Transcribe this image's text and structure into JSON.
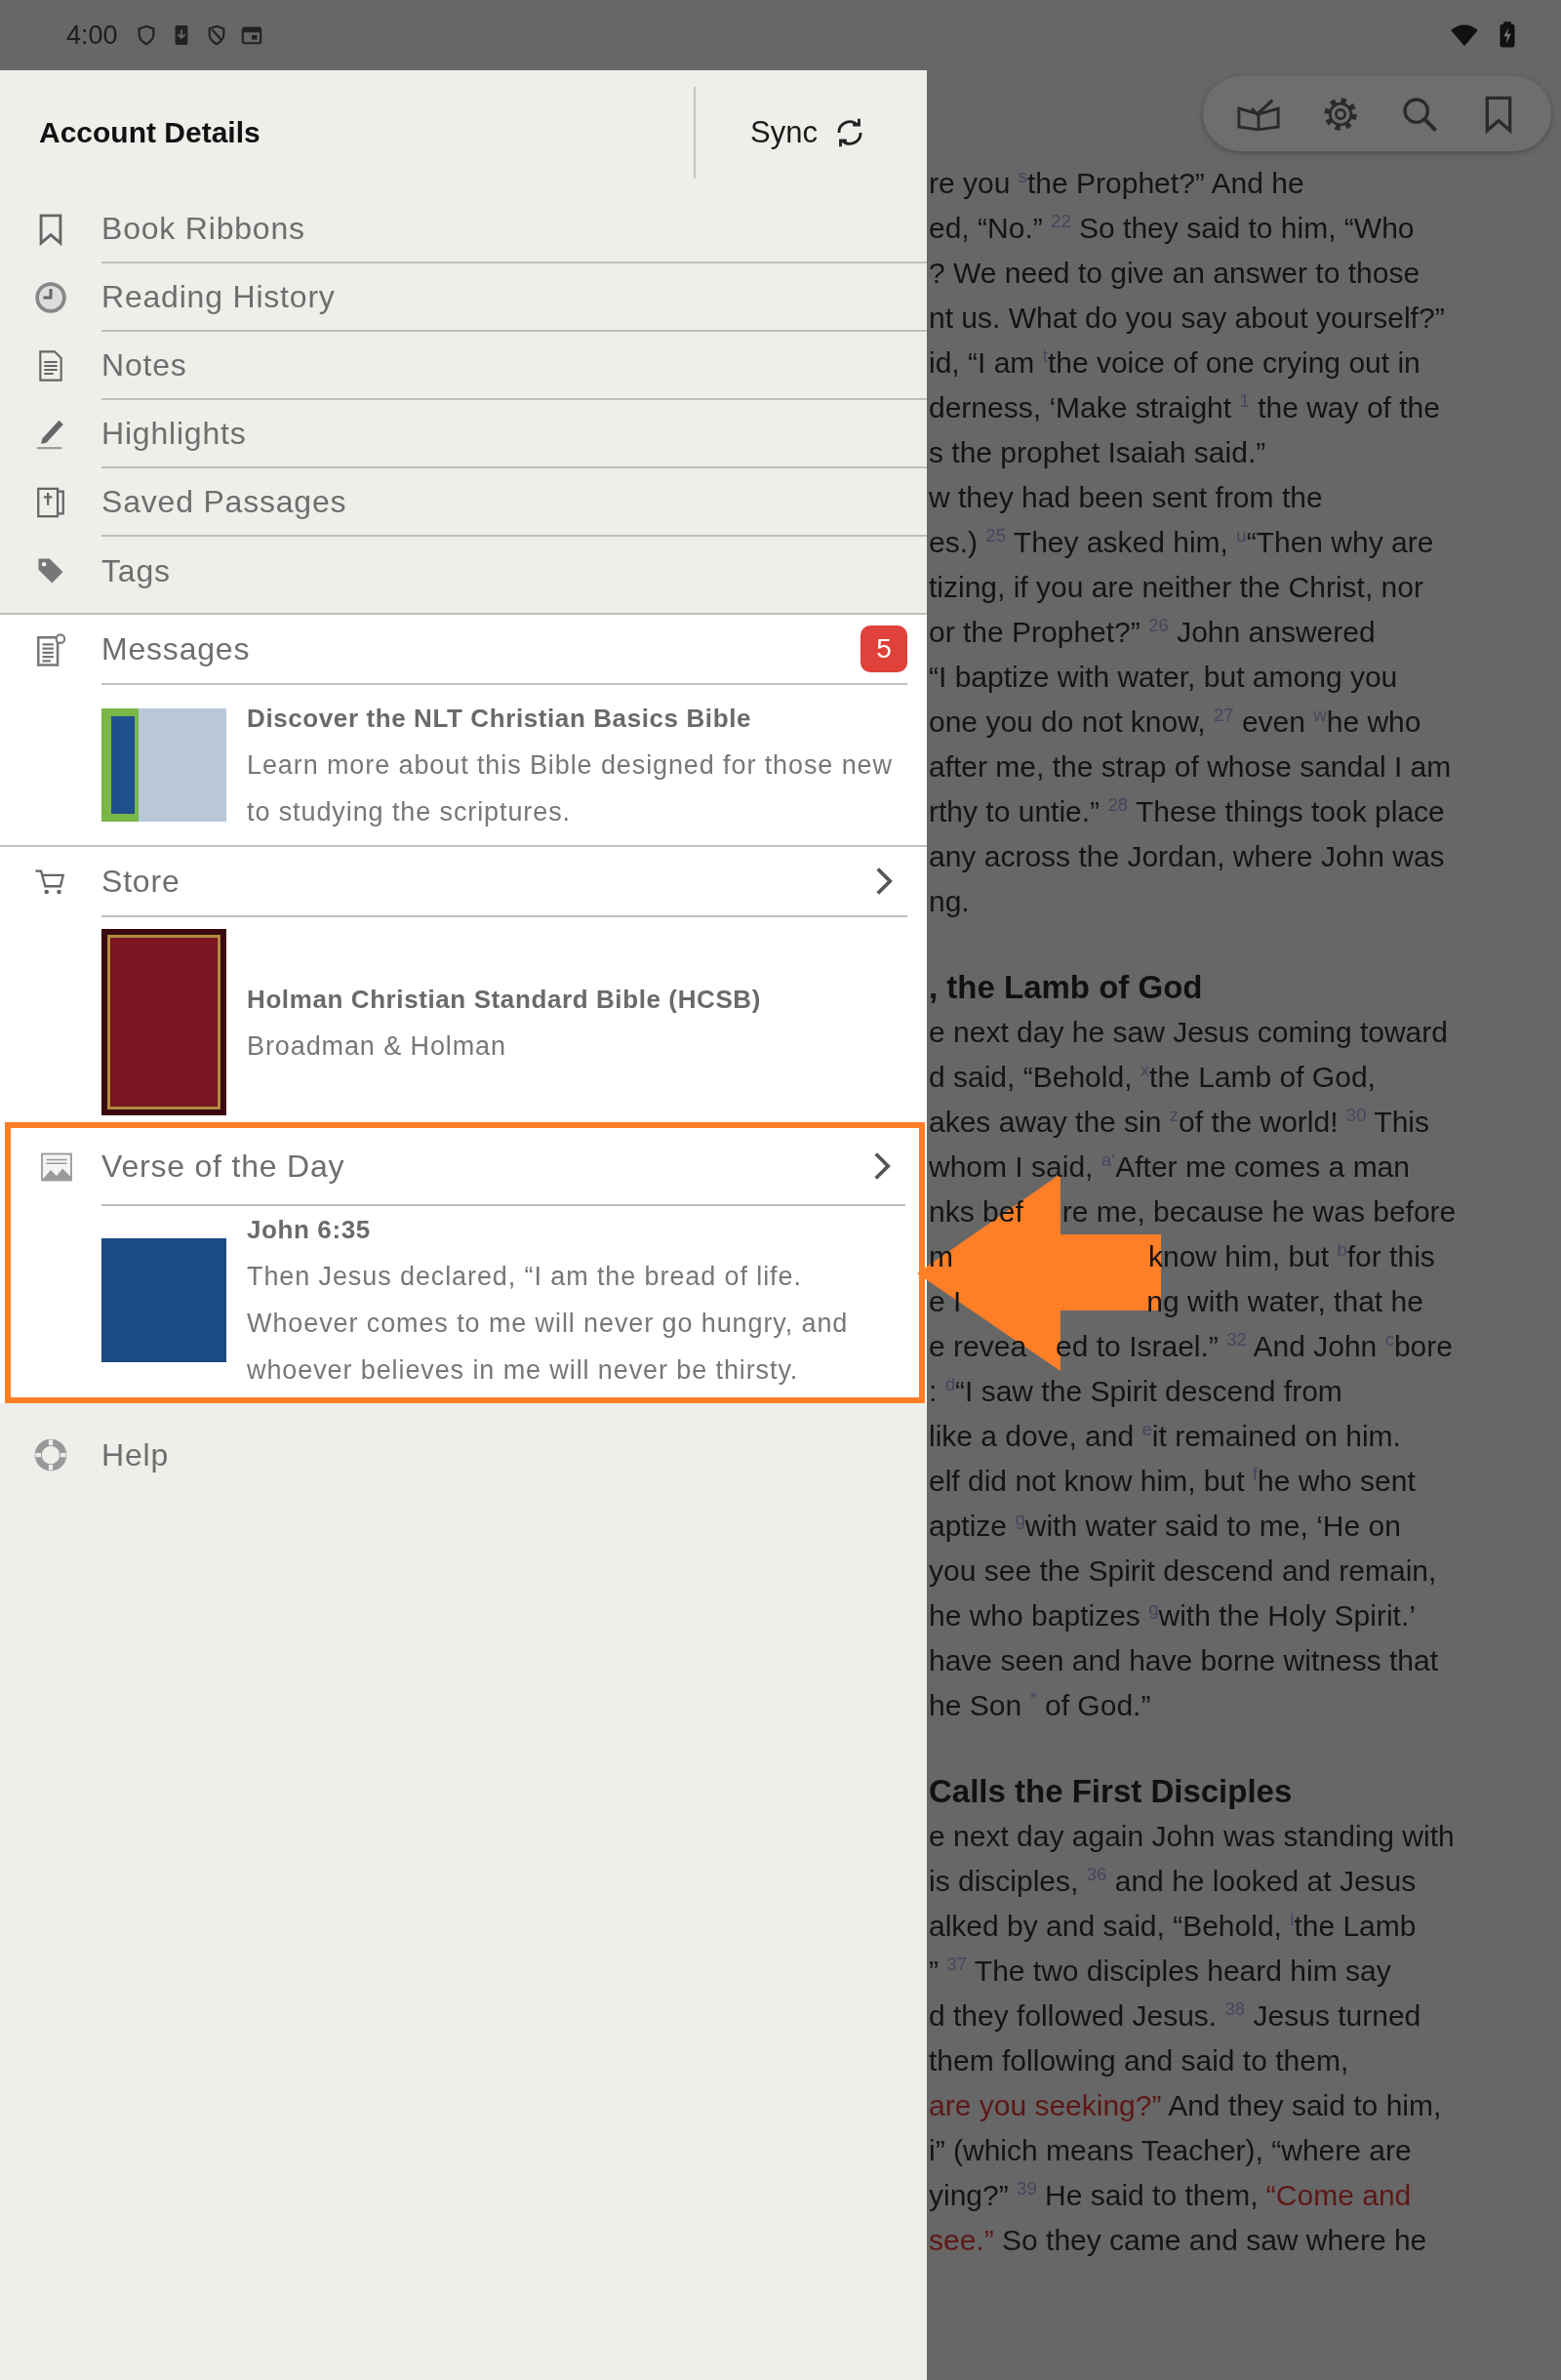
{
  "status_bar": {
    "time": "4:00"
  },
  "drawer": {
    "title": "Account Details",
    "sync_label": "Sync",
    "menu": [
      {
        "label": "Book Ribbons",
        "kind": "ribbon"
      },
      {
        "label": "Reading History",
        "kind": "history"
      },
      {
        "label": "Notes",
        "kind": "notes"
      },
      {
        "label": "Highlights",
        "kind": "highlights"
      },
      {
        "label": "Saved Passages",
        "kind": "passages"
      },
      {
        "label": "Tags",
        "kind": "tags"
      }
    ],
    "messages": {
      "label": "Messages",
      "badge": "5",
      "card": {
        "title": "Discover the NLT Christian Basics Bible",
        "text": "Learn more about this Bible designed for those new to studying the scriptures."
      }
    },
    "store": {
      "label": "Store",
      "card": {
        "title": "Holman Christian Standard Bible (HCSB)",
        "author": "Broadman & Holman"
      }
    },
    "verse_of_the_day": {
      "label": "Verse of the Day",
      "highlighted": true,
      "card": {
        "reference": "John 6:35",
        "text": "Then Jesus declared, “I am the bread of life. Whoever comes to me will never go hungry, and whoever believes in me will never be thirsty."
      }
    },
    "help": {
      "label": "Help"
    }
  },
  "reader": {
    "sections": [
      {
        "lines": [
          {
            "text": "re you $^{s}$the Prophet?” And he"
          },
          {
            "text": "ed, “No.” $^{22}$ So they said to him, “Who"
          },
          {
            "text": "? We need to give an answer to those"
          },
          {
            "text": "nt us. What do you say about yourself?”"
          },
          {
            "text": "id, “I am $^{t}$the voice of one crying out in"
          },
          {
            "text": "derness, ‘Make straight $^{1}$ the way of the"
          },
          {
            "text": "s the prophet Isaiah said.”"
          },
          {
            "text": "w they had been sent from the"
          },
          {
            "text": "es.) $^{25}$ They asked him, $^{u}$“Then why are"
          },
          {
            "text": "tizing, if you are neither the Christ, nor"
          },
          {
            "text": "or the Prophet?” $^{26}$ John answered"
          },
          {
            "text": "“I baptize with water, but among you"
          },
          {
            "text": "one you do not know, $^{27}$ even $^{w}$he who"
          },
          {
            "text": "after me, the strap of whose sandal I am"
          },
          {
            "text": "rthy to untie.” $^{28}$ These things took place"
          },
          {
            "text": "any across the Jordan, where John was"
          },
          {
            "text": "ng."
          }
        ]
      },
      {
        "heading": ", the Lamb of God",
        "lines": [
          {
            "text": "e next day he saw Jesus coming toward"
          },
          {
            "text": "d said, “Behold, $^{x}$the Lamb of God,"
          },
          {
            "text": "akes away the sin $^{z}$of the world! $^{30}$ This"
          },
          {
            "text": "whom I said, $^{a‘}$After me comes a man"
          },
          {
            "text": "nks bef",
            "after_gap": "re me, because he was before"
          },
          {
            "text": "m",
            "after_gap": "know him, but $^{b}$for this"
          },
          {
            "text": "e I",
            "after_gap": "ng with water, that he"
          },
          {
            "text": "e revea",
            "after_gap": "ed to Israel.” $^{32}$ And John $^{c}$bore"
          },
          {
            "text": ": $^{d}$“I saw the Spirit descend from"
          },
          {
            "text": "like a dove, and $^{e}$it remained on him."
          },
          {
            "text": "elf did not know him, but $^{f}$he who sent"
          },
          {
            "text": "aptize $^{g}$with water said to me, ‘He on"
          },
          {
            "text": "you see the Spirit descend and remain,"
          },
          {
            "text": "he who baptizes $^{g}$with the Holy Spirit.’"
          },
          {
            "text": "have seen and have borne witness that"
          },
          {
            "text": "he Son $^{*}$ of God.”"
          }
        ]
      },
      {
        "heading": "Calls the First Disciples",
        "lines": [
          {
            "text": "e next day again John was standing with"
          },
          {
            "text": "is disciples, $^{36}$ and he looked at Jesus"
          },
          {
            "text": "alked by and said, “Behold, $^{i}$the Lamb"
          },
          {
            "text": "” $^{37}$ The two disciples heard him say"
          },
          {
            "text": "d they followed Jesus. $^{38}$ Jesus turned"
          },
          {
            "text": "them following and said to them,"
          },
          {
            "parts": [
              {
                "text": "are you seeking?”",
                "red": true
              },
              {
                "text": " And they said to him,",
                "red": false
              }
            ]
          },
          {
            "text": "i” (which means Teacher), “where are"
          },
          {
            "parts": [
              {
                "text": "ying?” $^{39}$ He said to them, ",
                "red": false
              },
              {
                "text": "“Come and",
                "red": true
              }
            ]
          },
          {
            "parts": [
              {
                "text": "see.”",
                "red": true
              },
              {
                "text": " So they came and saw where he",
                "red": false
              }
            ]
          }
        ]
      }
    ]
  }
}
